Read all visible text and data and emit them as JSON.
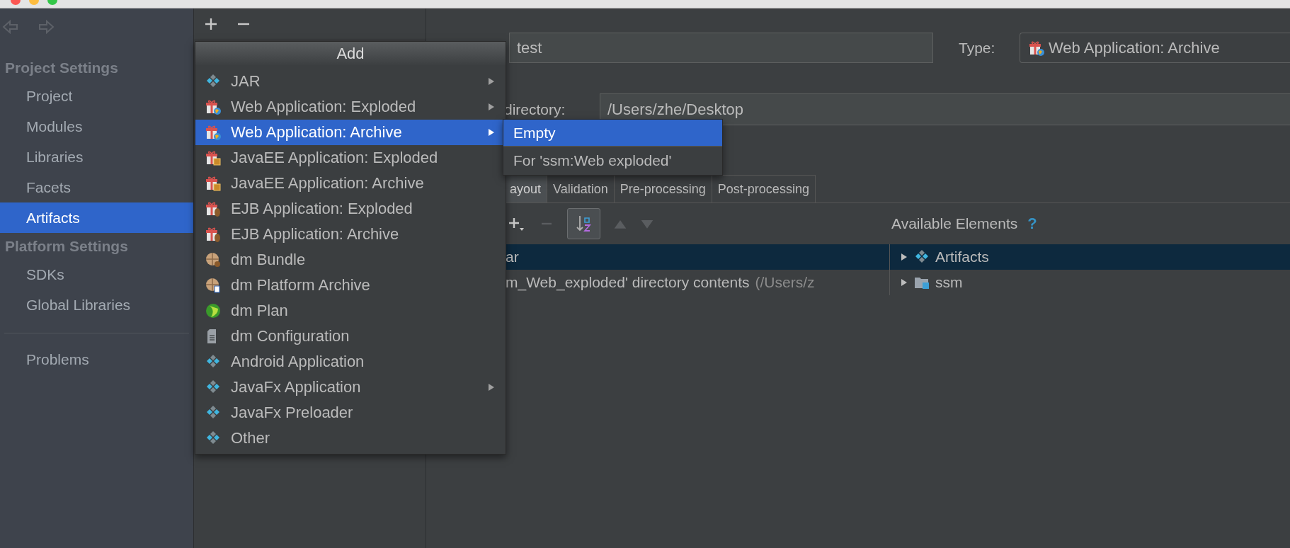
{
  "sidebar": {
    "sections": [
      {
        "title": "Project Settings",
        "items": [
          {
            "label": "Project",
            "selected": false
          },
          {
            "label": "Modules",
            "selected": false
          },
          {
            "label": "Libraries",
            "selected": false
          },
          {
            "label": "Facets",
            "selected": false
          },
          {
            "label": "Artifacts",
            "selected": true
          }
        ]
      },
      {
        "title": "Platform Settings",
        "items": [
          {
            "label": "SDKs",
            "selected": false
          },
          {
            "label": "Global Libraries",
            "selected": false
          }
        ]
      }
    ],
    "footer_items": [
      {
        "label": "Problems",
        "selected": false
      }
    ]
  },
  "add_menu": {
    "title": "Add",
    "items": [
      {
        "label": "JAR",
        "kind": "modules",
        "has_submenu": true,
        "selected": false
      },
      {
        "label": "Web Application: Exploded",
        "kind": "web",
        "has_submenu": true,
        "selected": false
      },
      {
        "label": "Web Application: Archive",
        "kind": "web",
        "has_submenu": true,
        "selected": true
      },
      {
        "label": "JavaEE Application: Exploded",
        "kind": "javaee",
        "has_submenu": false,
        "selected": false
      },
      {
        "label": "JavaEE Application: Archive",
        "kind": "javaee",
        "has_submenu": false,
        "selected": false
      },
      {
        "label": "EJB Application: Exploded",
        "kind": "ejb",
        "has_submenu": false,
        "selected": false
      },
      {
        "label": "EJB Application: Archive",
        "kind": "ejb",
        "has_submenu": false,
        "selected": false
      },
      {
        "label": "dm Bundle",
        "kind": "bundle",
        "has_submenu": false,
        "selected": false
      },
      {
        "label": "dm Platform Archive",
        "kind": "bundle-archive",
        "has_submenu": false,
        "selected": false
      },
      {
        "label": "dm Plan",
        "kind": "plan",
        "has_submenu": false,
        "selected": false
      },
      {
        "label": "dm Configuration",
        "kind": "config",
        "has_submenu": false,
        "selected": false
      },
      {
        "label": "Android Application",
        "kind": "modules",
        "has_submenu": false,
        "selected": false
      },
      {
        "label": "JavaFx Application",
        "kind": "modules",
        "has_submenu": true,
        "selected": false
      },
      {
        "label": "JavaFx Preloader",
        "kind": "modules",
        "has_submenu": false,
        "selected": false
      },
      {
        "label": "Other",
        "kind": "modules",
        "has_submenu": false,
        "selected": false
      }
    ]
  },
  "submenu": {
    "items": [
      {
        "label": "Empty",
        "selected": true
      },
      {
        "label": "For 'ssm:Web exploded'",
        "selected": false
      }
    ]
  },
  "editor": {
    "name_field": {
      "value": "test"
    },
    "type_label": "Type:",
    "type_combo": {
      "value": "Web Application: Archive"
    },
    "directory_label": "directory:",
    "directory_field": {
      "value": "/Users/zhe/Desktop"
    },
    "tabs": [
      {
        "label": "ayout",
        "selected": true
      },
      {
        "label": "Validation",
        "selected": false
      },
      {
        "label": "Pre-processing",
        "selected": false
      },
      {
        "label": "Post-processing",
        "selected": false
      }
    ],
    "sort_toggle": {
      "on": true
    },
    "layout_tree": [
      {
        "label": "ar",
        "selected": true
      },
      {
        "label": "m_Web_exploded' directory contents",
        "detail": "(/Users/z",
        "selected": false
      }
    ],
    "available_header": "Available Elements",
    "help": "?",
    "available_tree": [
      {
        "label": "Artifacts",
        "kind": "modules",
        "expanded": false,
        "selected": true
      },
      {
        "label": "ssm",
        "kind": "folder",
        "expanded": false,
        "selected": false
      }
    ]
  }
}
